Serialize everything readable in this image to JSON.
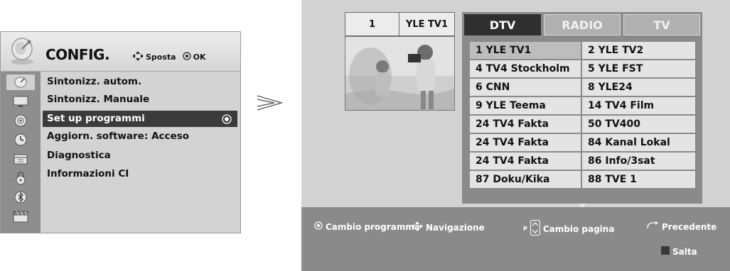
{
  "menu": {
    "title": "CONFIG.",
    "hint_move": "Sposta",
    "hint_ok": "OK",
    "items": [
      {
        "label": "Sintonizz. autom.",
        "value": ""
      },
      {
        "label": "Sintonizz. Manuale",
        "value": ""
      },
      {
        "label": "Set up programmi",
        "value": "",
        "selected": true
      },
      {
        "label": "Aggiorn. software",
        "value": ": Acceso"
      },
      {
        "label": "Diagnostica",
        "value": ""
      },
      {
        "label": "Informazioni CI",
        "value": ""
      }
    ],
    "side_icons": [
      "satellite-dish-icon",
      "monitor-icon",
      "speaker-icon",
      "clock-icon",
      "calendar-icon",
      "lock-icon",
      "bluetooth-icon",
      "clapperboard-icon"
    ]
  },
  "preview": {
    "channel_number": "1",
    "channel_name": "YLE TV1"
  },
  "tabs": [
    {
      "label": "DTV",
      "active": true
    },
    {
      "label": "RADIO",
      "active": false
    },
    {
      "label": "TV",
      "active": false
    }
  ],
  "channels": {
    "left": [
      "1 YLE TV1",
      "4 TV4 Stockholm",
      "6 CNN",
      "9 YLE Teema",
      "24 TV4 Fakta",
      "24 TV4 Fakta",
      "24 TV4 Fakta",
      "87 Doku/Kika"
    ],
    "right": [
      "2 YLE TV2",
      "5 YLE FST",
      "8 YLE24",
      "14 TV4 Film",
      "50 TV400",
      "84 Kanal Lokal",
      "86 Info/3sat",
      "88 TVE 1"
    ]
  },
  "footer": {
    "change_program": "Cambio programma",
    "navigation": "Navigazione",
    "page_change": "Cambio pagina",
    "page_key": "P",
    "previous": "Precedente",
    "skip": "Salta"
  },
  "colors": {
    "panel_bg": "#d2d2d2",
    "frame": "#8a8a8a",
    "selected_menu": "#3b3b3b",
    "active_tab": "#2f2f2f"
  }
}
